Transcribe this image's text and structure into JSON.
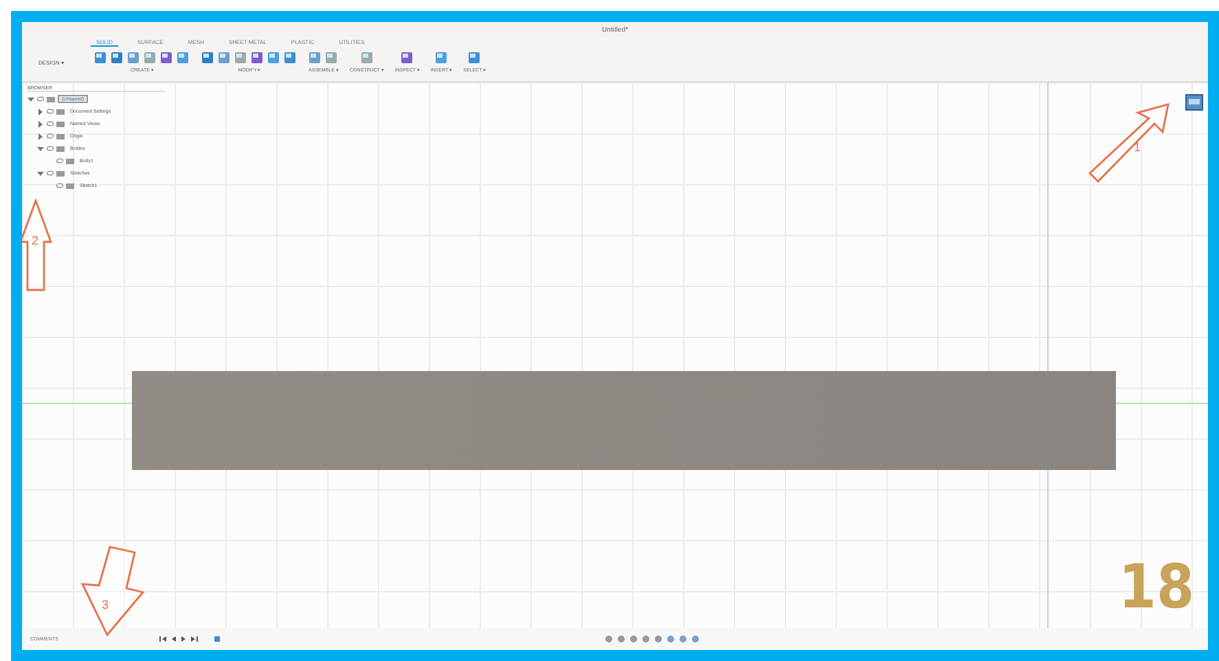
{
  "window": {
    "title": "Untitled*"
  },
  "tabs": [
    {
      "label": "SOLID",
      "selected": true
    },
    {
      "label": "SURFACE",
      "selected": false
    },
    {
      "label": "MESH",
      "selected": false
    },
    {
      "label": "SHEET METAL",
      "selected": false
    },
    {
      "label": "PLASTIC",
      "selected": false
    },
    {
      "label": "UTILITIES",
      "selected": false
    }
  ],
  "workspace": "DESIGN ▾",
  "groups": [
    {
      "label": "CREATE ▾"
    },
    {
      "label": "MODIFY ▾"
    },
    {
      "label": "ASSEMBLE ▾"
    },
    {
      "label": "CONSTRUCT ▾"
    },
    {
      "label": "INSPECT ▾"
    },
    {
      "label": "INSERT ▾"
    },
    {
      "label": "SELECT ▾"
    }
  ],
  "browser": {
    "title": "BROWSER",
    "items": [
      {
        "label": "(Unsaved)",
        "expanded": true,
        "children": [
          {
            "label": "Document Settings",
            "expanded": false
          },
          {
            "label": "Named Views",
            "expanded": false
          },
          {
            "label": "Origin",
            "expanded": false
          },
          {
            "label": "Bodies",
            "expanded": true,
            "children": [
              {
                "label": "Body1"
              }
            ]
          },
          {
            "label": "Sketches",
            "expanded": true,
            "children": [
              {
                "label": "Sketch1"
              }
            ]
          }
        ]
      }
    ]
  },
  "comments": "COMMENTS",
  "callouts": [
    "1",
    "2",
    "3"
  ],
  "page_number": "18"
}
